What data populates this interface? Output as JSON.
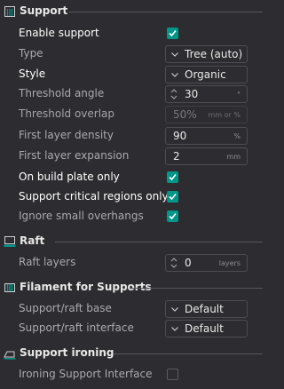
{
  "sections": {
    "support": {
      "title": "Support"
    },
    "raft": {
      "title": "Raft"
    },
    "filament": {
      "title": "Filament for Supports"
    },
    "ironing": {
      "title": "Support ironing"
    }
  },
  "support": {
    "enable_support": {
      "label": "Enable support",
      "checked": true
    },
    "type": {
      "label": "Type",
      "value": "Tree (auto)"
    },
    "style": {
      "label": "Style",
      "value": "Organic"
    },
    "threshold_angle": {
      "label": "Threshold angle",
      "value": "30",
      "unit": "°"
    },
    "threshold_overlap": {
      "label": "Threshold overlap",
      "value": "50%",
      "unit": "mm or %"
    },
    "first_layer_density": {
      "label": "First layer density",
      "value": "90",
      "unit": "%"
    },
    "first_layer_expansion": {
      "label": "First layer expansion",
      "value": "2",
      "unit": "mm"
    },
    "on_build_plate_only": {
      "label": "On build plate only",
      "checked": true
    },
    "support_critical_regions_only": {
      "label": "Support critical regions only",
      "checked": true
    },
    "ignore_small_overhangs": {
      "label": "Ignore small overhangs",
      "checked": true
    }
  },
  "raft": {
    "raft_layers": {
      "label": "Raft layers",
      "value": "0",
      "unit": "layers"
    }
  },
  "filament": {
    "support_raft_base": {
      "label": "Support/raft base",
      "value": "Default"
    },
    "support_raft_interface": {
      "label": "Support/raft interface",
      "value": "Default"
    }
  },
  "ironing": {
    "ironing_support_interface": {
      "label": "Ironing Support Interface",
      "checked": false
    }
  },
  "colors": {
    "background": "#2d2d31",
    "accent": "#009688",
    "text_primary": "#ffffff",
    "text_secondary": "#a9a9ae"
  }
}
